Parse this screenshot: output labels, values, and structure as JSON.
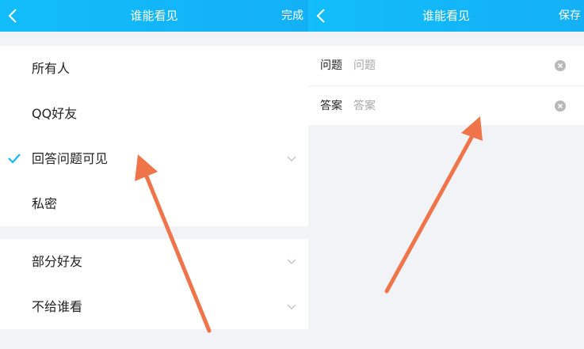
{
  "left": {
    "title": "谁能看见",
    "action": "完成",
    "options": [
      {
        "label": "所有人"
      },
      {
        "label": "QQ好友"
      },
      {
        "label": "回答问题可见"
      },
      {
        "label": "私密"
      }
    ],
    "more_options": [
      {
        "label": "部分好友"
      },
      {
        "label": "不给谁看"
      }
    ]
  },
  "right": {
    "title": "谁能看见",
    "action": "保存",
    "question": {
      "label": "问题",
      "placeholder": "问题"
    },
    "answer": {
      "label": "答案",
      "placeholder": "答案"
    }
  },
  "colors": {
    "accent": "#13b7f8",
    "annotation_arrow": "#f0744a"
  }
}
